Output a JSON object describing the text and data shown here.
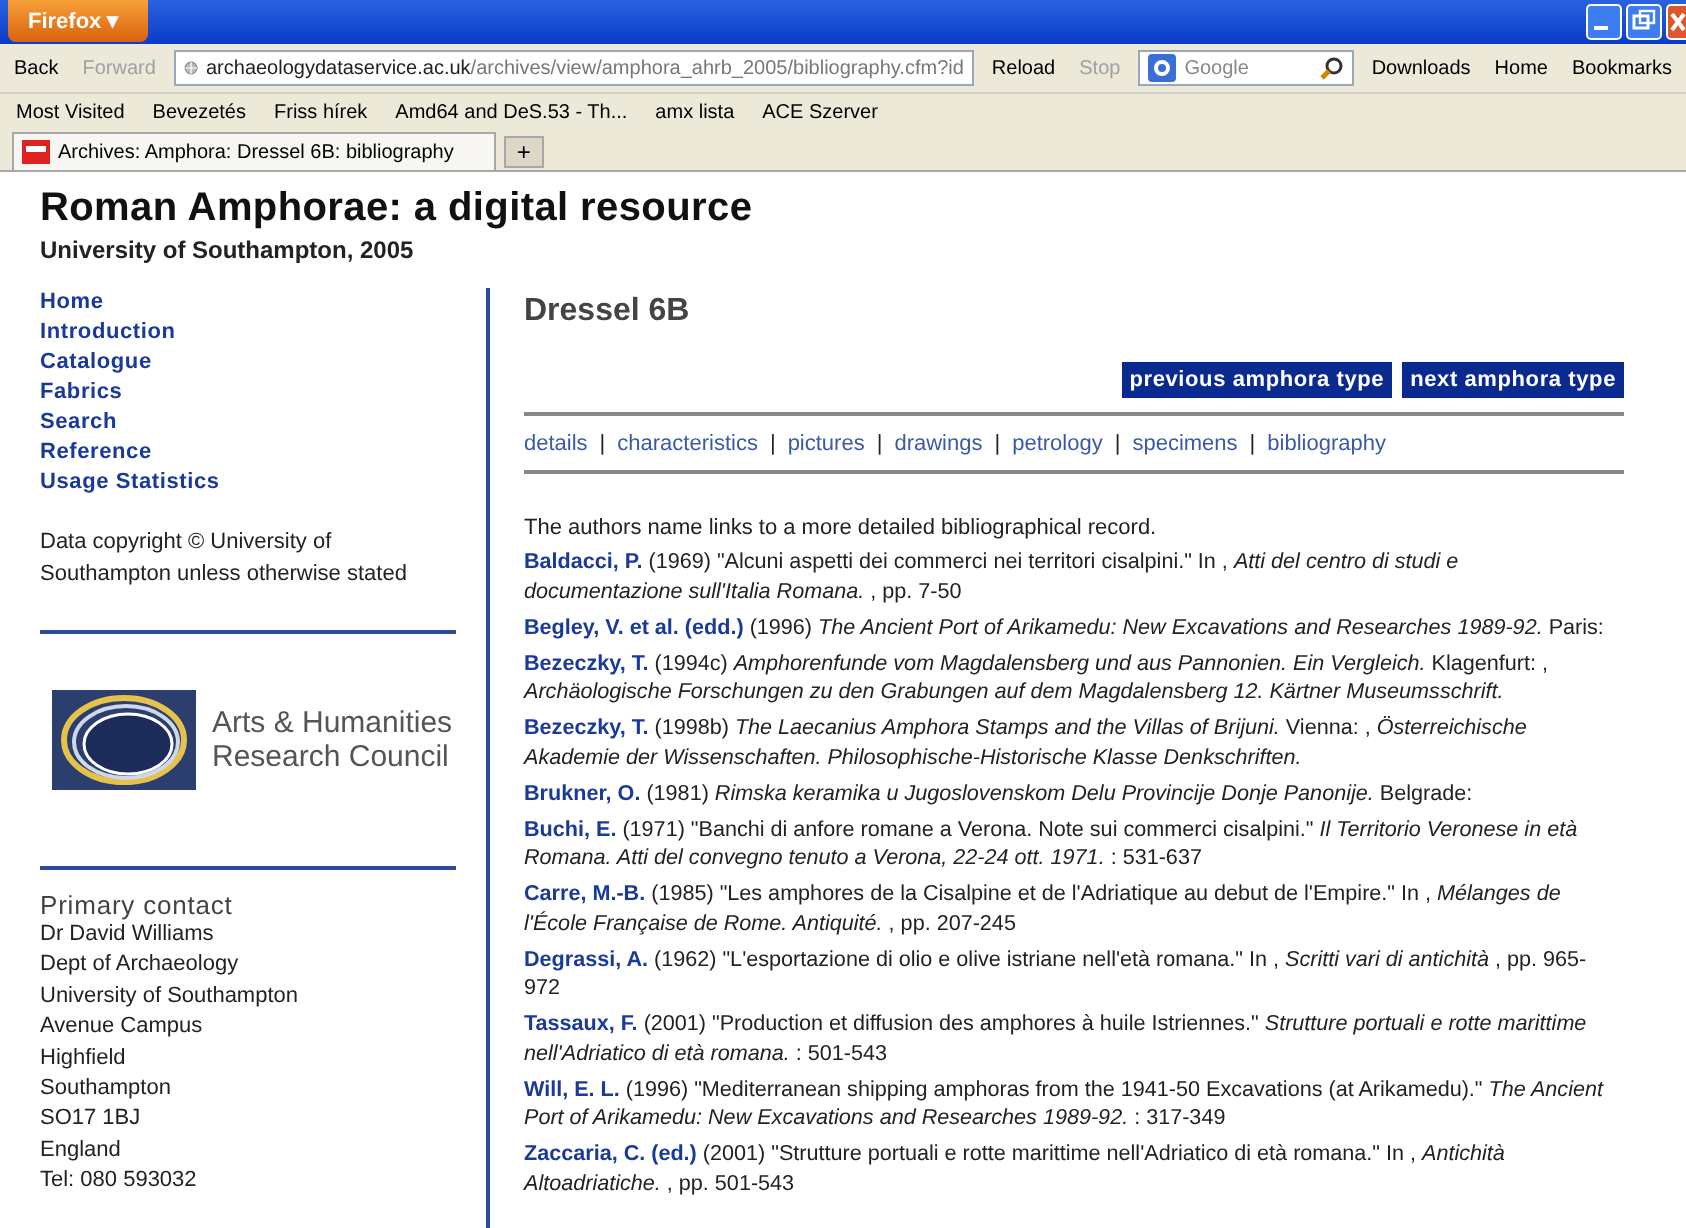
{
  "browser": {
    "menu_button": "Firefox ▾",
    "nav": {
      "back": {
        "label": "Back",
        "disabled": false
      },
      "forward": {
        "label": "Forward",
        "disabled": true
      },
      "reload": {
        "label": "Reload",
        "disabled": false
      },
      "stop": {
        "label": "Stop",
        "disabled": true
      }
    },
    "url": {
      "host": "archaeologydataservice.ac.uk",
      "path": "/archives/view/amphora_ahrb_2005/bibliography.cfm?id"
    },
    "search": {
      "engine": "Google"
    },
    "toolbar_buttons": [
      "Downloads",
      "Home",
      "Bookmarks"
    ],
    "bookmarks": [
      "Most Visited",
      "Bevezetés",
      "Friss hírek",
      "Amd64 and DeS.53 - Th...",
      "amx lista",
      "ACE Szerver"
    ],
    "tabs": [
      {
        "title": "Archives: Amphora: Dressel 6B: bibliography",
        "selected": true
      }
    ],
    "new_tab": "+"
  },
  "site": {
    "title": "Roman Amphorae: a digital resource",
    "subtitle": "University of Southampton, 2005"
  },
  "sidebar": {
    "nav": [
      "Home",
      "Introduction",
      "Catalogue",
      "Fabrics",
      "Search",
      "Reference",
      "Usage Statistics"
    ],
    "copyright": "Data copyright © University of Southampton unless otherwise stated",
    "logo": {
      "line_1": "Arts & Humanities",
      "line_2": "Research Council"
    },
    "contact": {
      "heading": "Primary contact",
      "lines": [
        "Dr David Williams",
        "Dept of Archaeology",
        "University of Southampton",
        "Avenue Campus",
        "Highfield",
        "Southampton",
        "SO17 1BJ",
        "England",
        "Tel: 080 593032"
      ]
    }
  },
  "main": {
    "heading": "Dressel 6B",
    "buttons": [
      "previous amphora type",
      "next amphora type"
    ],
    "subnav": {
      "separator": "|",
      "links": [
        "details",
        "characteristics",
        "pictures",
        "drawings",
        "petrology",
        "specimens",
        "bibliography"
      ]
    },
    "intro": "The authors name links to a more detailed bibliographical record.",
    "entries": [
      {
        "author": "Baldacci, P.",
        "text": "(1969) \"Alcuni aspetti dei commerci nei territori cisalpini.\" In , *Atti del centro di studi e documentazione sull'Italia Romana.* , pp. 7-50"
      },
      {
        "author": "Begley, V. et al. (edd.)",
        "text": "(1996) *The Ancient Port of Arikamedu: New Excavations and Researches 1989-92.* Paris:"
      },
      {
        "author": "Bezeczky, T.",
        "text": "(1994c) *Amphorenfunde vom Magdalensberg und aus Pannonien. Ein Vergleich.* Klagenfurt: , *Archäologische Forschungen zu den Grabungen auf dem Magdalensberg 12. Kärtner Museumsschrift.*"
      },
      {
        "author": "Bezeczky, T.",
        "text": "(1998b) *The Laecanius Amphora Stamps and the Villas of Brijuni.* Vienna: , *Österreichische Akademie der Wissenschaften. Philosophische-Historische Klasse Denkschriften.*"
      },
      {
        "author": "Brukner, O.",
        "text": "(1981) *Rimska keramika u Jugoslovenskom Delu Provincije Donje Panonije.* Belgrade:"
      },
      {
        "author": "Buchi, E.",
        "text": "(1971) \"Banchi di anfore romane a Verona. Note sui commerci cisalpini.\" *Il Territorio Veronese in età Romana. Atti del convegno tenuto a Verona, 22-24 ott. 1971.* : 531-637"
      },
      {
        "author": "Carre, M.-B.",
        "text": "(1985) \"Les amphores de la Cisalpine et de l'Adriatique au debut de l'Empire.\" In , *Mélanges de l'École Française de Rome. Antiquité.* , pp. 207-245"
      },
      {
        "author": "Degrassi, A.",
        "text": "(1962) \"L'esportazione di olio e olive istriane nell'età romana.\" In , *Scritti vari di antichità* , pp. 965-972"
      },
      {
        "author": "Tassaux, F.",
        "text": "(2001) \"Production et diffusion des amphores à huile Istriennes.\" *Strutture portuali e rotte marittime nell'Adriatico di età romana.* : 501-543"
      },
      {
        "author": "Will, E. L.",
        "text": "(1996) \"Mediterranean shipping amphoras from the 1941-50 Excavations (at Arikamedu).\" *The Ancient Port of Arikamedu: New Excavations and Researches 1989-92.* : 317-349"
      },
      {
        "author": "Zaccaria, C. (ed.)",
        "text": "(2001) \"Strutture portuali e rotte marittime nell'Adriatico di età romana.\" In , *Antichità Altoadriatiche.* , pp. 501-543"
      }
    ]
  }
}
